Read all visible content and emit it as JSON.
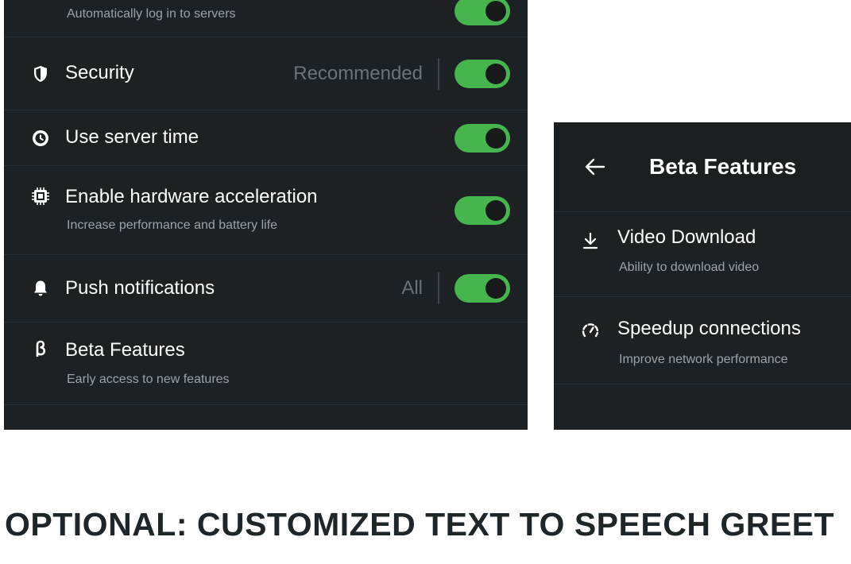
{
  "settings": {
    "auto_login": {
      "subtitle": "Automatically log in to servers",
      "enabled": true
    },
    "security": {
      "title": "Security",
      "value": "Recommended",
      "enabled": true,
      "icon": "shield-icon"
    },
    "server_time": {
      "title": "Use server time",
      "enabled": true,
      "icon": "clock-icon"
    },
    "hardware_accel": {
      "title": "Enable hardware acceleration",
      "subtitle": "Increase performance and battery life",
      "enabled": true,
      "icon": "chip-icon"
    },
    "push": {
      "title": "Push notifications",
      "value": "All",
      "enabled": true,
      "icon": "bell-icon"
    },
    "beta": {
      "title": "Beta Features",
      "subtitle": "Early access to new features",
      "icon": "beta-icon"
    }
  },
  "beta_page": {
    "title": "Beta Features",
    "items": [
      {
        "title": "Video Download",
        "subtitle": "Ability to download video",
        "icon": "download-icon"
      },
      {
        "title": "Speedup connections",
        "subtitle": "Improve network performance",
        "icon": "speedometer-icon"
      }
    ]
  },
  "caption": "OPTIONAL: CUSTOMIZED TEXT TO SPEECH GREET",
  "colors": {
    "panel_bg": "#1b1f22",
    "toggle_on": "#47b54e",
    "text_primary": "#ffffff",
    "text_secondary": "#9ba3a8",
    "text_value": "#6b7378"
  }
}
